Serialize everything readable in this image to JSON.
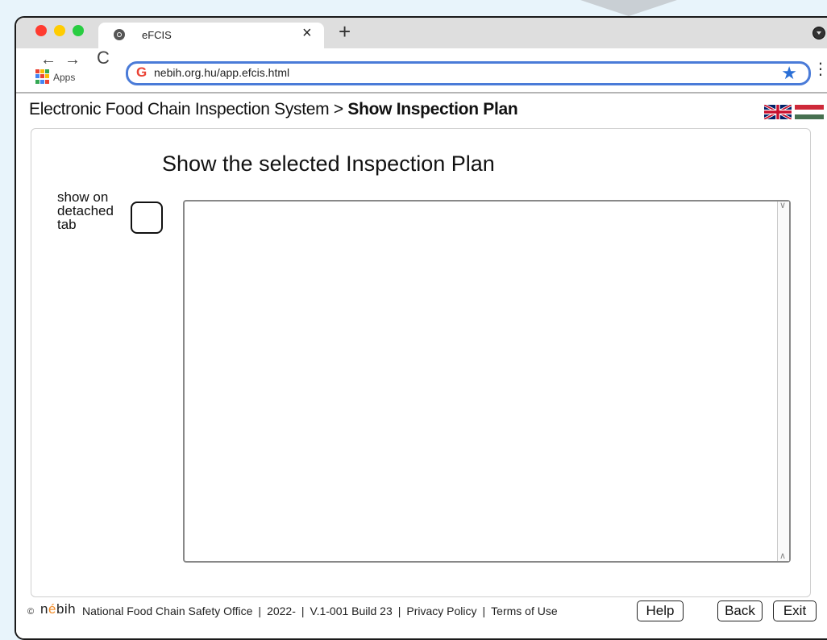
{
  "window": {
    "tab_title": "eFCIS",
    "url": "nebih.org.hu/app.efcis.html",
    "apps_label": "Apps"
  },
  "icons": {
    "close_tab": "×",
    "new_tab": "+",
    "back": "←",
    "forward": "→",
    "reload": "C",
    "google": "G",
    "bookmark": "★",
    "menu": "⋮"
  },
  "page": {
    "breadcrumb_root": "Electronic Food Chain Inspection System",
    "breadcrumb_sep": " > ",
    "breadcrumb_current": "Show Inspection Plan",
    "panel_title": "Show the selected Inspection Plan",
    "detach_label": "show on detached tab",
    "detach_checked": false,
    "textarea_value": ""
  },
  "footer": {
    "copyright_symbol": "©",
    "logo_text": "nébih",
    "organization": "National Food Chain Safety Office",
    "year": "2022-",
    "version": "V.1-001 Build 23",
    "privacy": "Privacy Policy",
    "terms": "Terms of Use",
    "separator": "|",
    "help_label": "Help",
    "back_label": "Back",
    "exit_label": "Exit"
  },
  "colors": {
    "omnibox_border": "#4a7bd8",
    "traffic_red": "#ff3b30",
    "traffic_yellow": "#ffcc00",
    "traffic_green": "#28cd41",
    "flag_hu_red": "#ce2939",
    "flag_hu_white": "#ffffff",
    "flag_hu_green": "#477050",
    "logo_accent": "#f28c28"
  }
}
